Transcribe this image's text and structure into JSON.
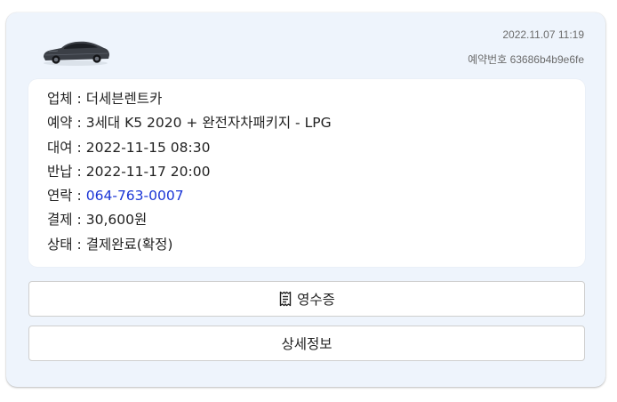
{
  "header": {
    "car_icon": "car-image",
    "date": "2022.11.07 11:19",
    "reservation_label": "예약번호",
    "reservation_number": "63686b4b9e6fe"
  },
  "details": [
    {
      "label": "업체",
      "value": "더세븐렌트카"
    },
    {
      "label": "예약",
      "value": "3세대 K5 2020 + 완전자차패키지 - LPG"
    },
    {
      "label": "대여",
      "value": "2022-11-15 08:30"
    },
    {
      "label": "반납",
      "value": "2022-11-17 20:00"
    },
    {
      "label": "연락",
      "value": "064-763-0007"
    },
    {
      "label": "결제",
      "value": "30,600원"
    },
    {
      "label": "상태",
      "value": "결제완료(확정)"
    }
  ],
  "separator": ":",
  "buttons": {
    "receipt_icon": "receipt-icon",
    "receipt_label": "영수증",
    "detail_label": "상세정보"
  },
  "colors": {
    "card_bg": "#eef4fc",
    "link": "#1a35d6"
  }
}
